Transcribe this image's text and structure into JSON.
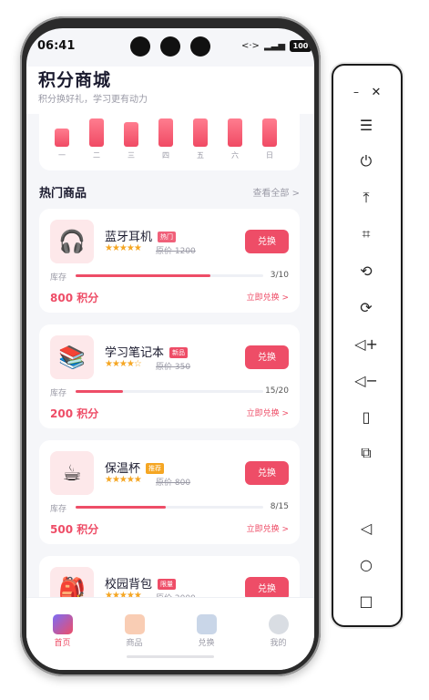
{
  "status": {
    "time": "06:41",
    "battery": "100"
  },
  "header": {
    "title": "积分商城",
    "subtitle": "积分换好礼，学习更有动力"
  },
  "chart_data": {
    "type": "bar",
    "categories": [
      "一",
      "二",
      "三",
      "四",
      "五",
      "六",
      "日"
    ],
    "values": [
      0.52,
      0.82,
      0.72,
      0.82,
      0.82,
      0.82,
      0.82
    ]
  },
  "section": {
    "title": "热门商品",
    "view_all": "查看全部 >"
  },
  "stock_label": "库存",
  "products": [
    {
      "name": "蓝牙耳机",
      "tag": "热门",
      "tag_color": "#f0617a",
      "stars": "★★★★★",
      "orig": "原价 1200",
      "button": "兑换",
      "stock": "3/10",
      "stock_ratio": 0.72,
      "points": "800 积分",
      "redeem": "立即兑换 >",
      "icon": "🎧"
    },
    {
      "name": "学习笔记本",
      "tag": "新品",
      "tag_color": "#ee4d67",
      "stars": "★★★★☆",
      "orig": "原价 350",
      "button": "兑换",
      "stock": "15/20",
      "stock_ratio": 0.25,
      "points": "200 积分",
      "redeem": "立即兑换 >",
      "icon": "📚"
    },
    {
      "name": "保温杯",
      "tag": "推荐",
      "tag_color": "#f5a623",
      "stars": "★★★★★",
      "orig": "原价 800",
      "button": "兑换",
      "stock": "8/15",
      "stock_ratio": 0.48,
      "points": "500 积分",
      "redeem": "立即兑换 >",
      "icon": "☕"
    },
    {
      "name": "校园背包",
      "tag": "限量",
      "tag_color": "#ee4d67",
      "stars": "★★★★★",
      "orig": "原价 2000",
      "button": "兑换",
      "stock": "",
      "stock_ratio": 0,
      "points": "",
      "redeem": "",
      "icon": "🎒"
    }
  ],
  "tabs": [
    {
      "label": "首页",
      "active": true,
      "icon": "shopping-bags-icon"
    },
    {
      "label": "商品",
      "active": false,
      "icon": "gift-icon"
    },
    {
      "label": "兑换",
      "active": false,
      "icon": "exchange-icon"
    },
    {
      "label": "我的",
      "active": false,
      "icon": "user-icon"
    }
  ],
  "colors": {
    "accent": "#ee4d67",
    "star": "#f5a623",
    "background": "#f5f6f9"
  }
}
